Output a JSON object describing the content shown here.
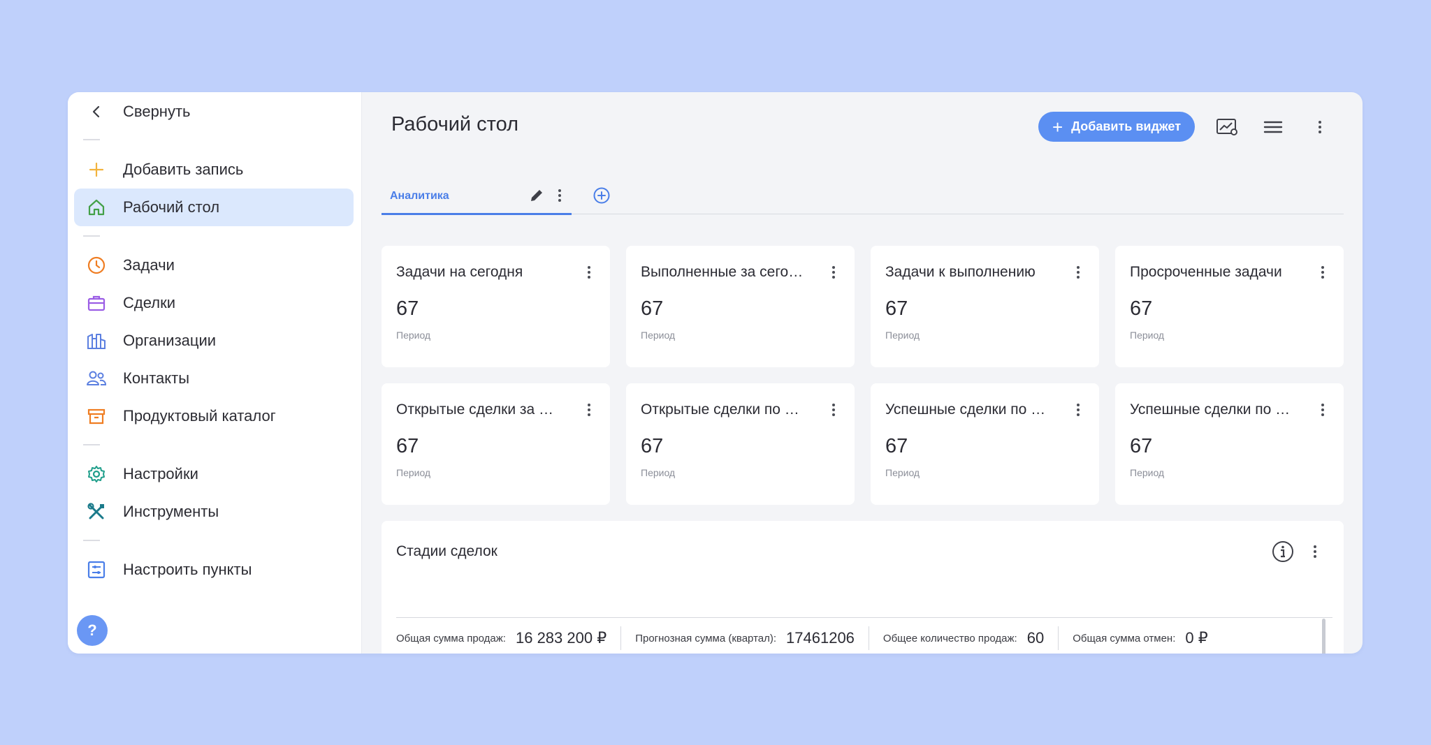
{
  "sidebar": {
    "collapse_label": "Свернуть",
    "add_record_label": "Добавить запись",
    "items": [
      {
        "label": "Рабочий стол",
        "icon": "home-icon",
        "active": true
      },
      {
        "label": "Задачи",
        "icon": "clock-icon"
      },
      {
        "label": "Сделки",
        "icon": "briefcase-icon"
      },
      {
        "label": "Организации",
        "icon": "buildings-icon"
      },
      {
        "label": "Контакты",
        "icon": "people-icon"
      },
      {
        "label": "Продуктовый каталог",
        "icon": "archive-box-icon"
      },
      {
        "label": "Настройки",
        "icon": "gear-icon"
      },
      {
        "label": "Инструменты",
        "icon": "tools-icon"
      },
      {
        "label": "Настроить пункты",
        "icon": "sliders-icon"
      }
    ],
    "help_label": "?"
  },
  "header": {
    "title": "Рабочий стол",
    "add_widget_label": "Добавить виджет"
  },
  "tabs": [
    {
      "label": "Аналитика",
      "active": true
    }
  ],
  "widgets": [
    {
      "title": "Задачи на сегодня",
      "value": "67",
      "sub": "Период"
    },
    {
      "title": "Выполненные за сего…",
      "value": "67",
      "sub": "Период"
    },
    {
      "title": "Задачи к выполнению",
      "value": "67",
      "sub": "Период"
    },
    {
      "title": "Просроченные задачи",
      "value": "67",
      "sub": "Период"
    },
    {
      "title": "Открытые сделки за …",
      "value": "67",
      "sub": "Период"
    },
    {
      "title": "Открытые сделки по …",
      "value": "67",
      "sub": "Период"
    },
    {
      "title": "Успешные сделки по …",
      "value": "67",
      "sub": "Период"
    },
    {
      "title": "Успешные сделки по …",
      "value": "67",
      "sub": "Период"
    }
  ],
  "stages": {
    "title": "Стадии сделок",
    "summary": [
      {
        "label": "Общая сумма продаж:",
        "value": "16 283 200 ₽"
      },
      {
        "label": "Прогнозная сумма (квартал):",
        "value": "17461206"
      },
      {
        "label": "Общее количество продаж:",
        "value": "60"
      },
      {
        "label": "Общая сумма отмен:",
        "value": "0 ₽"
      }
    ]
  },
  "colors": {
    "background": "#bfd0fb",
    "accent": "#5b8ff2",
    "active_row": "#dbe8fd"
  }
}
